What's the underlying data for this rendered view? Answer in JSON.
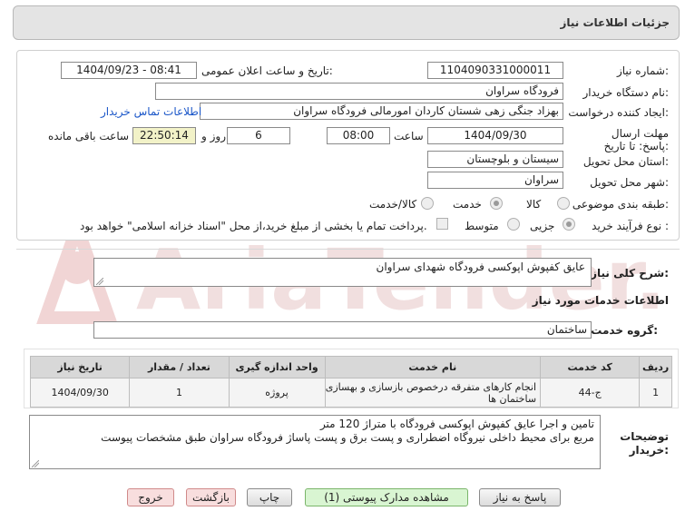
{
  "header": {
    "title": "جزئیات اطلاعات نیاز"
  },
  "form": {
    "need_number": {
      "label": "شماره نیاز:",
      "value": "1104090331000011"
    },
    "announce_datetime": {
      "label": "تاریخ و ساعت اعلان عمومی:",
      "value": "1404/09/23 - 08:41"
    },
    "buyer_org": {
      "label": "نام دستگاه خریدار:",
      "value": "فرودگاه سراوان"
    },
    "creator": {
      "label": "ایجاد کننده درخواست:",
      "value": "بهزاد جنگی زهی شستان کاردان امورمالی فرودگاه سراوان",
      "contact_link": "اطلاعات تماس خریدار"
    },
    "deadline": {
      "label": "مهلت ارسال پاسخ: تا تاریخ:",
      "date": "1404/09/30",
      "time_label": "ساعت",
      "time": "08:00",
      "days": "6",
      "days_label": "روز و",
      "remaining": "22:50:14",
      "remaining_label": "ساعت باقی مانده"
    },
    "province": {
      "label": "استان محل تحویل:",
      "value": "سیستان و بلوچستان"
    },
    "city": {
      "label": "شهر محل تحویل:",
      "value": "سراوان"
    },
    "category": {
      "label": "طبقه بندی موضوعی:",
      "options": [
        "کالا",
        "خدمت",
        "کالا/خدمت"
      ],
      "selected": "خدمت"
    },
    "process": {
      "label": "نوع فرآیند خرید :",
      "options": [
        "جزیی",
        "متوسط"
      ],
      "selected": "جزیی",
      "payment_note": "پرداخت تمام یا بخشی از مبلغ خرید،از محل \"اسناد خزانه اسلامی\" خواهد بود."
    }
  },
  "summary": {
    "label": "شرح کلی نیاز:",
    "value": "عایق کفپوش اپوکسی فرودگاه شهدای سراوان"
  },
  "services": {
    "section_title": "اطلاعات خدمات مورد نیاز",
    "group_label": "گروه خدمت:",
    "group_value": "ساختمان",
    "columns": [
      "ردیف",
      "کد خدمت",
      "نام خدمت",
      "واحد اندازه گیری",
      "تعداد / مقدار",
      "تاریخ نیاز"
    ],
    "rows": [
      {
        "row": "1",
        "code": "ج-44",
        "name": "انجام کارهای متفرقه درخصوص بازسازی و بهسازی ساختمان ها",
        "unit": "پروژه",
        "qty": "1",
        "date": "1404/09/30"
      }
    ]
  },
  "buyer_notes": {
    "label": "توضیحات خریدار:",
    "line1": "تامین و اجرا عایق کفپوش اپوکسی فرودگاه با متراژ 120 متر",
    "line2": "مربع برای محیط داخلی نیروگاه اضطراری و پست برق و پست پاساژ فرودگاه سراوان طبق مشخصات پیوست"
  },
  "buttons": {
    "reply": "پاسخ به نیاز",
    "attachments": "مشاهده مدارک پیوستی (1)",
    "print": "چاپ",
    "back": "بازگشت",
    "exit": "خروج"
  },
  "watermark": "AriaTender.net",
  "colors": {
    "link": "#1a56c8",
    "yellow_box": "#f2f2c8",
    "watermark": "#e8b4b4"
  }
}
